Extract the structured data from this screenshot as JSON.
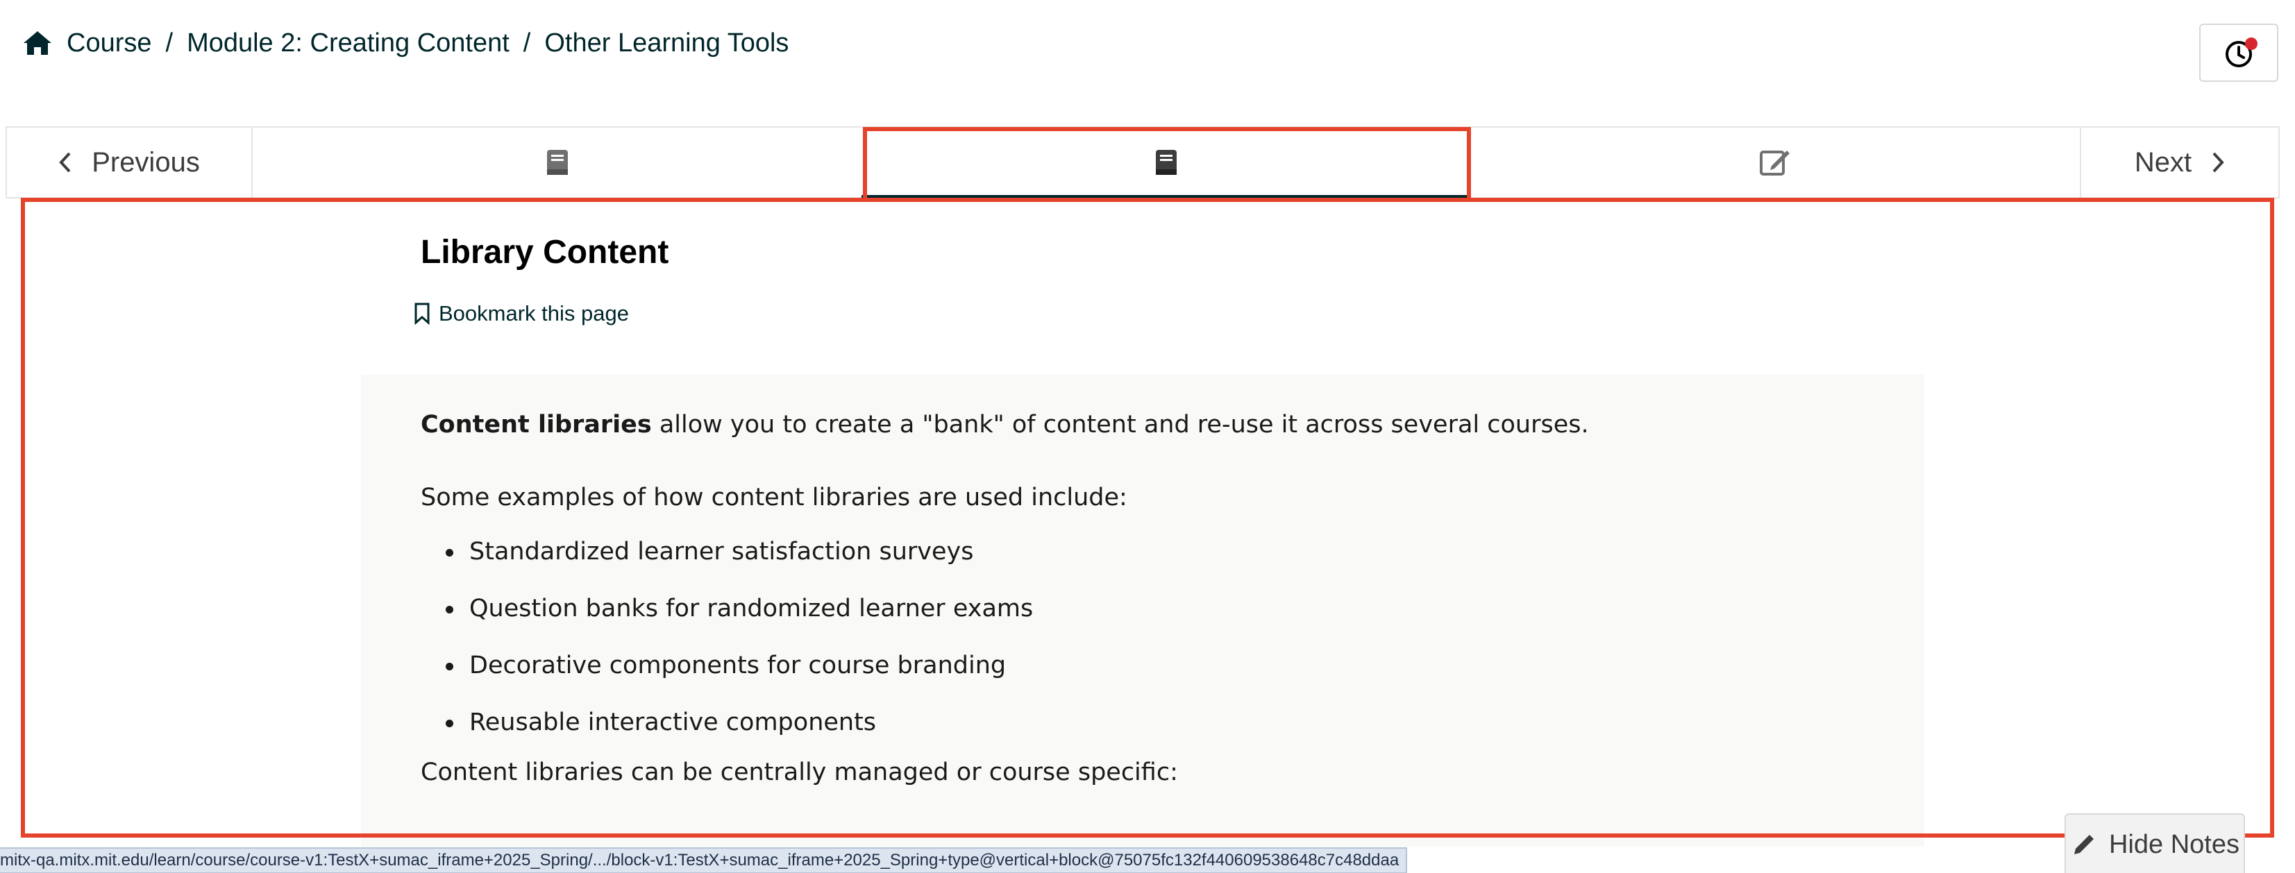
{
  "breadcrumb": {
    "course": "Course",
    "module": "Module 2: Creating Content",
    "section": "Other Learning Tools"
  },
  "seqnav": {
    "previous_label": "Previous",
    "next_label": "Next",
    "tabs": [
      {
        "icon": "book-icon",
        "active": false
      },
      {
        "icon": "book-icon",
        "active": true
      },
      {
        "icon": "edit-icon",
        "active": false
      }
    ]
  },
  "unit": {
    "title": "Library Content",
    "bookmark_label": "Bookmark this page"
  },
  "content": {
    "intro_bold": "Content libraries",
    "intro_rest": " allow you to create a \"bank\" of content and re-use it across several courses.",
    "examples_intro": "Some examples of how content libraries are used include:",
    "examples": [
      "Standardized learner satisfaction surveys",
      "Question banks for randomized learner exams",
      "Decorative components for course branding",
      "Reusable interactive components"
    ],
    "managed_text": "Content libraries can be centrally managed or course specific:"
  },
  "status_bar": {
    "url": "mitx-qa.mitx.mit.edu/learn/course/course-v1:TestX+sumac_iframe+2025_Spring/.../block-v1:TestX+sumac_iframe+2025_Spring+type@vertical+block@75075fc132f440609538648c7c48ddaa"
  },
  "notes": {
    "hide_label": "Hide Notes"
  },
  "colors": {
    "highlight": "#e5432c",
    "text": "#00262b",
    "content_bg": "#f9f9f7"
  }
}
